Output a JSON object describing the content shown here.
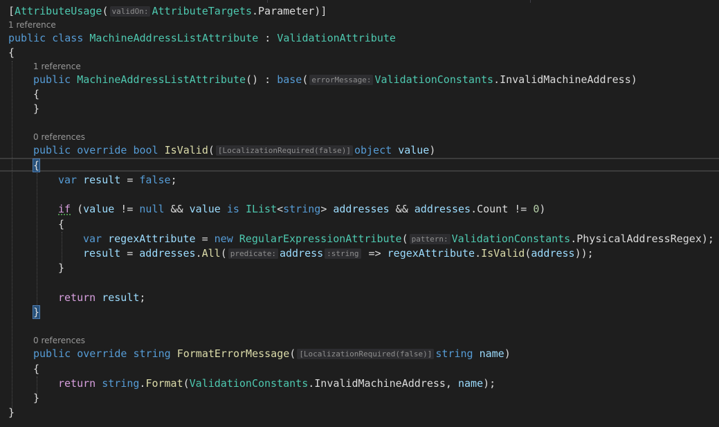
{
  "editor": {
    "language": "C#",
    "theme": "dark"
  },
  "code": {
    "l_attr": {
      "open": "[",
      "attr_name": "AttributeUsage",
      "paren_open": "(",
      "hint": "validOn:",
      "type_name": "AttributeTargets",
      "member": ".Parameter",
      "close": ")]"
    },
    "lens_class": "1 reference",
    "l_class": {
      "kw_public": "public",
      "kw_class": "class",
      "class_name": "MachineAddressListAttribute",
      "colon": " : ",
      "base_name": "ValidationAttribute"
    },
    "l_open1": "{",
    "lens_ctor": "1 reference",
    "l_ctor": {
      "kw_public": "public",
      "name": "MachineAddressListAttribute",
      "parens": "()",
      "colon": " : ",
      "kw_base": "base",
      "paren_open": "(",
      "hint": "errorMessage:",
      "type_name": "ValidationConstants",
      "member": ".InvalidMachineAddress)"
    },
    "l_ctor_open": "{",
    "l_ctor_close": "}",
    "lens_isvalid": "0 references",
    "l_isvalid": {
      "kw_public": "public",
      "kw_override": "override",
      "kw_bool": "bool",
      "name": "IsValid",
      "paren_open": "(",
      "hint": "[LocalizationRequired(false)]",
      "kw_object": "object",
      "param": "value",
      "paren_close": ")"
    },
    "l_isvalid_open": "{",
    "l_var": {
      "kw_var": "var",
      "name": "result",
      "eq": " = ",
      "kw_false": "false",
      "semi": ";"
    },
    "l_if": {
      "kw_if": "if",
      "p1": " (",
      "value": "value",
      "neq": " != ",
      "kw_null": "null",
      "and": " && ",
      "value2": "value",
      "kw_is": "is",
      "type": "IList",
      "lt": "<",
      "kw_string": "string",
      "gt": "> ",
      "var": "addresses",
      "and2": " && ",
      "var2": "addresses",
      "member": ".Count",
      "neq2": " != ",
      "zero": "0",
      "p2": ")"
    },
    "l_if_open": "{",
    "l_regex": {
      "kw_var": "var",
      "name": "regexAttribute",
      "eq": " = ",
      "kw_new": "new",
      "type": "RegularExpressionAttribute",
      "paren_open": "(",
      "hint": "pattern:",
      "type2": "ValidationConstants",
      "member": ".PhysicalAddressRegex",
      "end": ");"
    },
    "l_result": {
      "name": "result",
      "eq": " = ",
      "var": "addresses",
      "dot": ".",
      "fn": "All",
      "paren_open": "(",
      "hint": "predicate:",
      "param": "address",
      "hint2": ":string",
      "arrow": " => ",
      "var2": "regexAttribute",
      "dot2": ".",
      "fn2": "IsValid",
      "p_open": "(",
      "param2": "address",
      "end": "));"
    },
    "l_if_close": "}",
    "l_return": {
      "kw_return": "return",
      "name": "result",
      "semi": ";"
    },
    "l_isvalid_close": "}",
    "lens_format": "0 references",
    "l_format": {
      "kw_public": "public",
      "kw_override": "override",
      "kw_string": "string",
      "name": "FormatErrorMessage",
      "paren_open": "(",
      "hint": "[LocalizationRequired(false)]",
      "kw_string2": "string",
      "param": "name",
      "paren_close": ")"
    },
    "l_format_open": "{",
    "l_format_return": {
      "kw_return": "return",
      "kw_string": "string",
      "dot": ".",
      "fn": "Format",
      "paren_open": "(",
      "type": "ValidationConstants",
      "member": ".InvalidMachineAddress, ",
      "param": "name",
      "end": ");"
    },
    "l_format_close": "}",
    "l_close1": "}"
  }
}
